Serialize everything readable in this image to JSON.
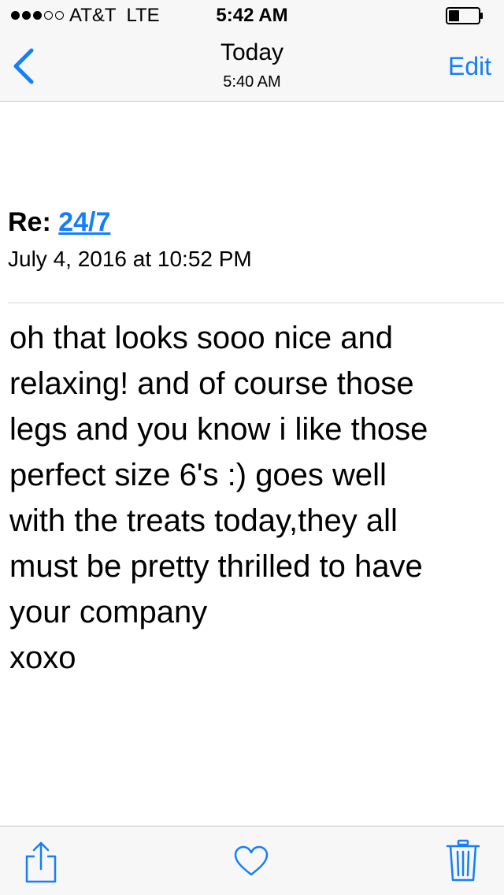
{
  "status_bar": {
    "carrier": "AT&T  LTE",
    "time": "5:42 AM",
    "signal_bars_filled": 3,
    "signal_bars_total": 5
  },
  "nav_bar": {
    "back_icon": "chevron-left-icon",
    "title": "Today",
    "subtitle": "5:40 AM",
    "edit_label": "Edit"
  },
  "message": {
    "subject_prefix": "Re: ",
    "subject_link": "24/7",
    "date": "July 4, 2016 at 10:52 PM",
    "body_lines": [
      "oh that looks sooo nice and",
      "relaxing! and of course those",
      "legs and you know i like those",
      "perfect size 6's :) goes well",
      "with the treats today,they all",
      "must be pretty thrilled to have",
      "your company",
      "xoxo"
    ]
  },
  "toolbar": {
    "items": [
      "share-icon",
      "heart-icon",
      "trash-icon"
    ]
  },
  "colors": {
    "accent": "#147efb",
    "bar_background": "#f7f7f7",
    "divider": "#c8c7cc"
  }
}
